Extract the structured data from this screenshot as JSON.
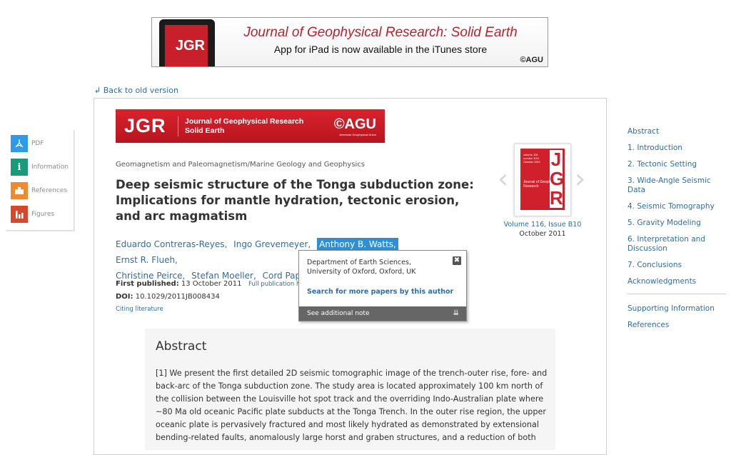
{
  "ad": {
    "title": "Journal of Geophysical Research: Solid Earth",
    "subtitle": "App for iPad is now available in the iTunes store",
    "publisher": "©AGU",
    "ipad_logo": "JGR"
  },
  "back_link": "↲ Back to old version",
  "side_tools": [
    {
      "label": "PDF",
      "icon": "pdf-icon",
      "color": "#2e9be8"
    },
    {
      "label": "Information",
      "icon": "info-icon",
      "color": "#1a9a7a"
    },
    {
      "label": "References",
      "icon": "references-icon",
      "color": "#ef8a2e"
    },
    {
      "label": "Figures",
      "icon": "figures-icon",
      "color": "#d7472a"
    }
  ],
  "journal_banner": {
    "logo": "JGR",
    "name_line1": "Journal of Geophysical Research",
    "name_line2": "Solid Earth",
    "publisher": "©AGU",
    "publisher_full": "American Geophysical Union",
    "color": "#c81b25"
  },
  "article": {
    "category": "Geomagnetism and Paleomagnetism/Marine Geology and Geophysics",
    "title": "Deep seismic structure of the Tonga subduction zone: Implications for mantle hydration, tectonic erosion, and arc magmatism",
    "authors": [
      "Eduardo Contreras-Reyes,",
      "Ingo Grevemeyer,",
      "Anthony B. Watts,",
      "Ernst R. Flueh,",
      "Christine Peirce,",
      "Stefan Moeller,",
      "Cord Papen"
    ],
    "first_published_label": "First published:",
    "first_published": "13 October 2011",
    "full_history_link": "Full publication his",
    "doi_label": "DOI:",
    "doi": "10.1029/2011JB008434",
    "citing_link": "Citing literature"
  },
  "issue": {
    "volume_issue": "Volume 116, Issue B10",
    "date": "October 2011",
    "cover_letters": "J G R",
    "cover_text": "Journal of Geophysical Research",
    "prev": "‹",
    "next": "›"
  },
  "author_popup": {
    "affiliation": "Department of Earth Sciences, University of Oxford, Oxford, UK",
    "search_link": "Search for more papers by this author",
    "note_label": "See additional note",
    "close": "✖",
    "expand": "»"
  },
  "abstract": {
    "heading": "Abstract",
    "text": "[1] We present the first detailed 2D seismic tomographic image of the trench-outer rise, fore- and back-arc of the Tonga subduction zone. The study area is located approximately 100 km north of the collision between the Louisville hot spot track and the overriding Indo-Australian plate where ~80 Ma old oceanic Pacific plate subducts at the Tonga Trench. In the outer rise region, the upper oceanic plate is pervasively fractured and most likely hydrated as demonstrated by extensional bending-related faults, anomalously large horst and graben structures, and a reduction of both"
  },
  "toc": {
    "items": [
      "Abstract",
      "1. Introduction",
      "2. Tectonic Setting",
      "3. Wide-Angle Seismic Data",
      "4. Seismic Tomography",
      "5. Gravity Modeling",
      "6. Interpretation and Discussion",
      "7. Conclusions",
      "Acknowledgments"
    ],
    "extra": [
      "Supporting Information",
      "References"
    ]
  }
}
